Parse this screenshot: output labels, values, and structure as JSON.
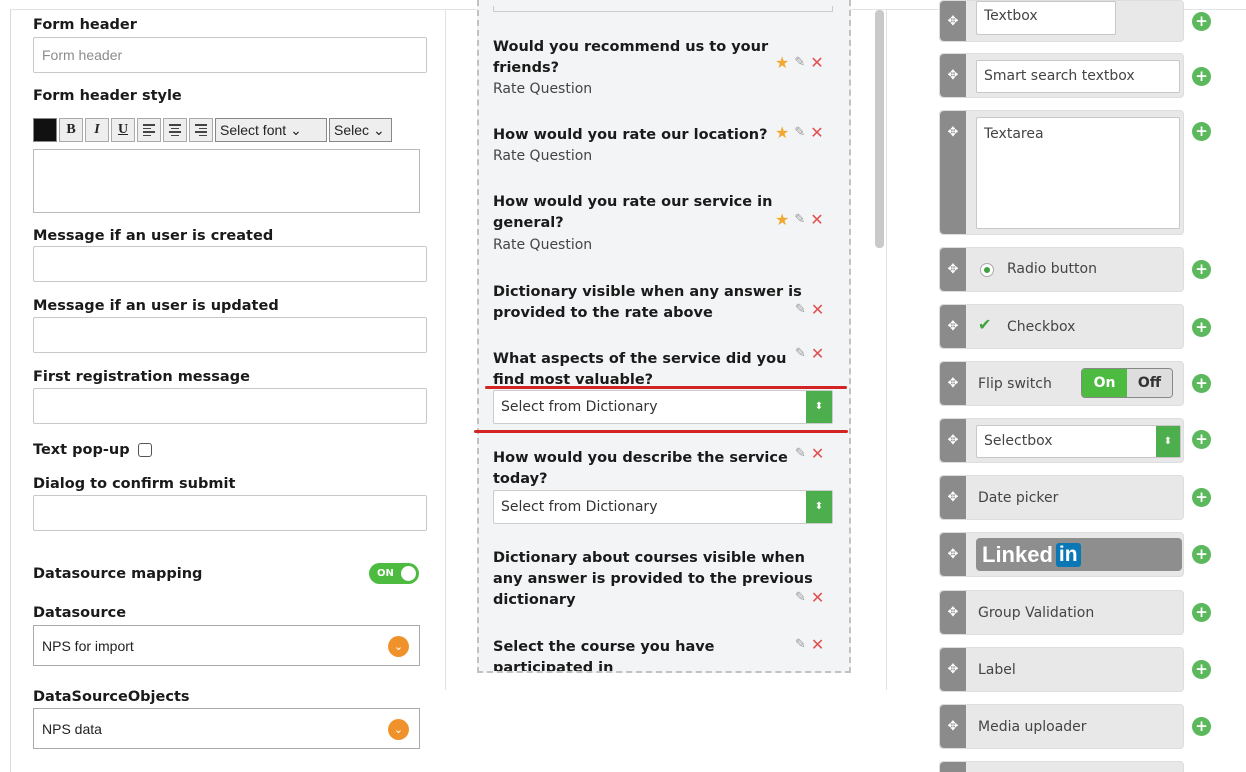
{
  "left": {
    "form_header_label": "Form header",
    "form_header_placeholder": "Form header",
    "form_header_style_label": "Form header style",
    "toolbar": {
      "bold": "B",
      "italic": "I",
      "underline": "U",
      "font_select": "Select font",
      "size_select": "Selec"
    },
    "msg_created_label": "Message if an user is created",
    "msg_updated_label": "Message if an user is updated",
    "first_reg_label": "First registration message",
    "text_popup_label": "Text pop-up",
    "dialog_confirm_label": "Dialog to confirm submit",
    "datasource_mapping_label": "Datasource mapping",
    "datasource_toggle": "ON",
    "datasource_label": "Datasource",
    "datasource_value": "NPS for import",
    "dso_label": "DataSourceObjects",
    "dso_value": "NPS data"
  },
  "middle": {
    "questions": [
      {
        "title": "Would you recommend us to your friends?",
        "type": "Rate Question"
      },
      {
        "title": "How would you rate our location?",
        "type": "Rate Question"
      },
      {
        "title": "How would you rate our service in general?",
        "type": "Rate Question"
      },
      {
        "title": "Dictionary visible when any answer is provided to the rate above"
      },
      {
        "title": "What aspects of the service did you find most valuable?",
        "select": "Select from Dictionary"
      },
      {
        "title": "How would you describe the service today?",
        "select": "Select from Dictionary"
      },
      {
        "title": "Dictionary about courses visible when any answer is provided to the previous dictionary"
      },
      {
        "title": "Select the course you have participated in"
      }
    ]
  },
  "palette": {
    "textbox": "Textbox",
    "smart_search": "Smart search textbox",
    "textarea": "Textarea",
    "radio": "Radio button",
    "checkbox": "Checkbox",
    "flip_label": "Flip switch",
    "flip_on": "On",
    "flip_off": "Off",
    "selectbox": "Selectbox",
    "date_picker": "Date picker",
    "linkedin_text": "Linked",
    "linkedin_in": "in",
    "group_validation": "Group Validation",
    "label": "Label",
    "media_uploader": "Media uploader"
  },
  "colors": {
    "accent_green": "#4cbb3f",
    "orange": "#f0922c",
    "red_marker": "#d42323"
  },
  "icons": [
    "move-icon",
    "plus-icon",
    "star-icon",
    "pencil-icon",
    "delete-icon",
    "chevron-down-icon"
  ]
}
